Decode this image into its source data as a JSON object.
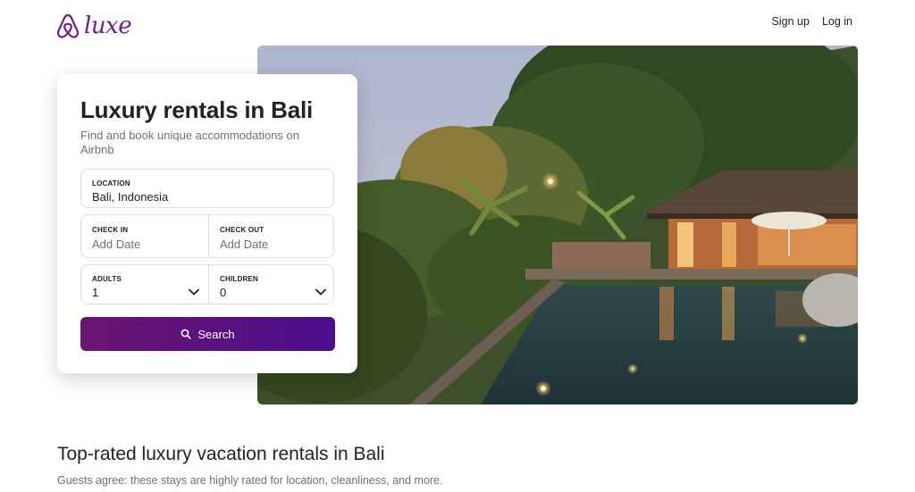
{
  "brand": {
    "wordmark": "luxe",
    "color": "#6b1f8b",
    "logo_icon": "airbnb-belo-icon"
  },
  "header": {
    "signup_label": "Sign up",
    "login_label": "Log in"
  },
  "search_card": {
    "title": "Luxury rentals in Bali",
    "subtitle": "Find and book unique accommodations on Airbnb",
    "location": {
      "label": "LOCATION",
      "value": "Bali, Indonesia"
    },
    "check_in": {
      "label": "CHECK IN",
      "placeholder": "Add Date"
    },
    "check_out": {
      "label": "CHECK OUT",
      "placeholder": "Add Date"
    },
    "adults": {
      "label": "ADULTS",
      "value": "1"
    },
    "children": {
      "label": "CHILDREN",
      "value": "0"
    },
    "search_button": {
      "label": "Search",
      "icon": "search-icon",
      "color": "#5a128a"
    }
  },
  "hero": {
    "description_icon": "villa-pool-photo"
  },
  "section": {
    "title": "Top-rated luxury vacation rentals in Bali",
    "subtitle": "Guests agree: these stays are highly rated for location, cleanliness, and more."
  }
}
